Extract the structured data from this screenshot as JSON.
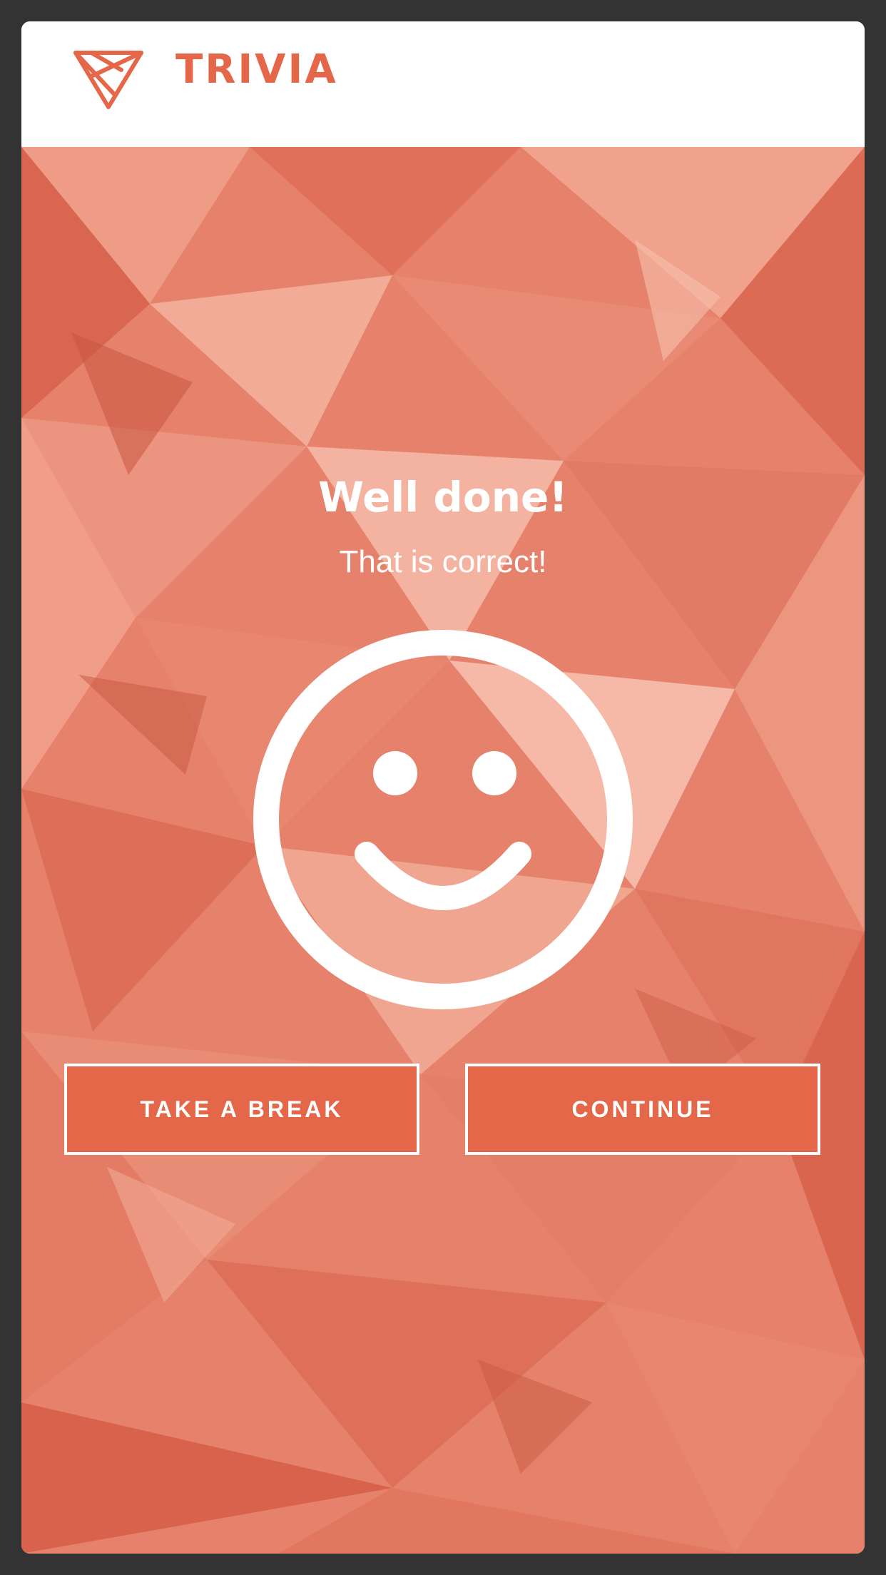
{
  "app": {
    "name": "TRIVIA",
    "brand_color": "#e5674a",
    "logo_icon": "inverted-triangle-logo-icon"
  },
  "result": {
    "headline": "Well done!",
    "message": "That is correct!",
    "icon": "smiley-face-icon"
  },
  "actions": {
    "take_break_label": "TAKE A BREAK",
    "continue_label": "CONTINUE"
  },
  "colors": {
    "background_frame": "#333333",
    "accent": "#e5674a",
    "text_on_accent": "#ffffff"
  }
}
